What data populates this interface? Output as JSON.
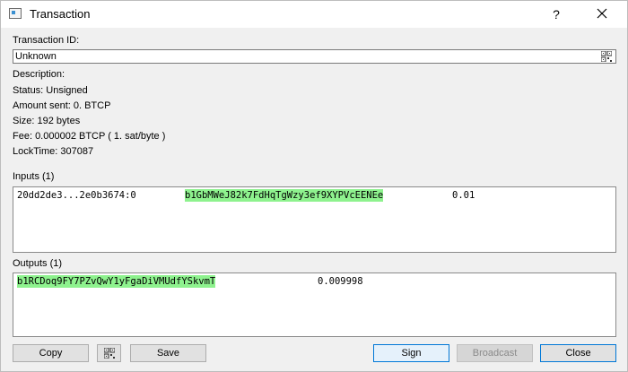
{
  "window": {
    "title": "Transaction",
    "help_glyph": "?",
    "icons": {
      "app": "window-app-icon",
      "close": "close-icon"
    }
  },
  "details": {
    "txid_label": "Transaction ID:",
    "txid_value": "Unknown",
    "description": "Description:",
    "status": "Status: Unsigned",
    "amount_sent": "Amount sent: 0. BTCP",
    "size": "Size: 192 bytes",
    "fee": "Fee: 0.000002 BTCP  ( 1. sat/byte )",
    "locktime": "LockTime: 307087"
  },
  "inputs": {
    "label": "Inputs (1)",
    "rows": [
      {
        "prevout": "20dd2de3...2e0b3674:0",
        "address": "b1GbMWeJ82k7FdHqTgWzy3ef9XYPVcEENEe",
        "amount": "0.01"
      }
    ]
  },
  "outputs": {
    "label": "Outputs (1)",
    "rows": [
      {
        "address": "b1RCDoq9FY7PZvQwY1yFgaDiVMUdfYSkvmT",
        "amount": "0.009998"
      }
    ]
  },
  "buttons": {
    "copy": "Copy",
    "save": "Save",
    "sign": "Sign",
    "broadcast": "Broadcast",
    "close": "Close"
  },
  "colors": {
    "address_highlight": "#8ef28e",
    "dialog_bg": "#f0f0f0",
    "primary_border": "#0078d7"
  }
}
